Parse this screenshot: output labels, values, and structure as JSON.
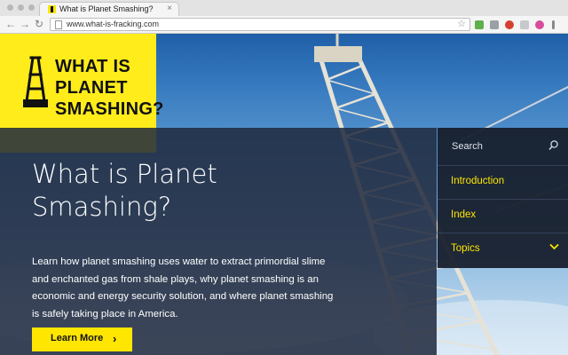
{
  "browser": {
    "tab": {
      "title": "What is Planet Smashing?",
      "close_glyph": "×"
    },
    "toolbar": {
      "back_glyph": "←",
      "forward_glyph": "→",
      "reload_glyph": "↻",
      "star_glyph": "☆"
    },
    "url": "www.what-is-fracking.com"
  },
  "logo": {
    "lines": [
      "WHAT IS",
      "PLANET",
      "SMASHING?"
    ]
  },
  "hero": {
    "title": "What is Planet Smashing?",
    "description": "Learn how planet smashing uses water to extract primordial slime and enchanted gas from shale plays, why planet smashing is an economic and energy security solution, and where planet smashing is safely taking place in America.",
    "cta": {
      "label": "Learn More",
      "arrow": "›"
    }
  },
  "menu": {
    "search_placeholder": "Search",
    "items": [
      {
        "label": "Introduction"
      },
      {
        "label": "Index"
      },
      {
        "label": "Topics"
      }
    ]
  },
  "colors": {
    "accent_yellow": "#ffe600",
    "panel_navy": "#1f293e",
    "sky_blue": "#3a7dc1"
  },
  "icons": [
    "rig-favicon",
    "page-icon",
    "star-icon",
    "search-icon",
    "chevron-down-icon",
    "oil-derrick-icon"
  ]
}
